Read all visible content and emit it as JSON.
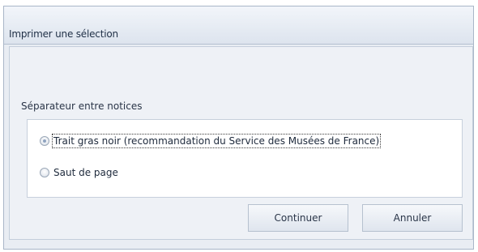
{
  "dialog": {
    "title": "Imprimer une sélection"
  },
  "group": {
    "label": "Séparateur entre notices",
    "options": [
      {
        "label": "Trait gras noir (recommandation du Service des Musées de France)",
        "selected": true
      },
      {
        "label": "Saut de page",
        "selected": false
      }
    ]
  },
  "buttons": {
    "continue_label": "Continuer",
    "cancel_label": "Annuler"
  }
}
